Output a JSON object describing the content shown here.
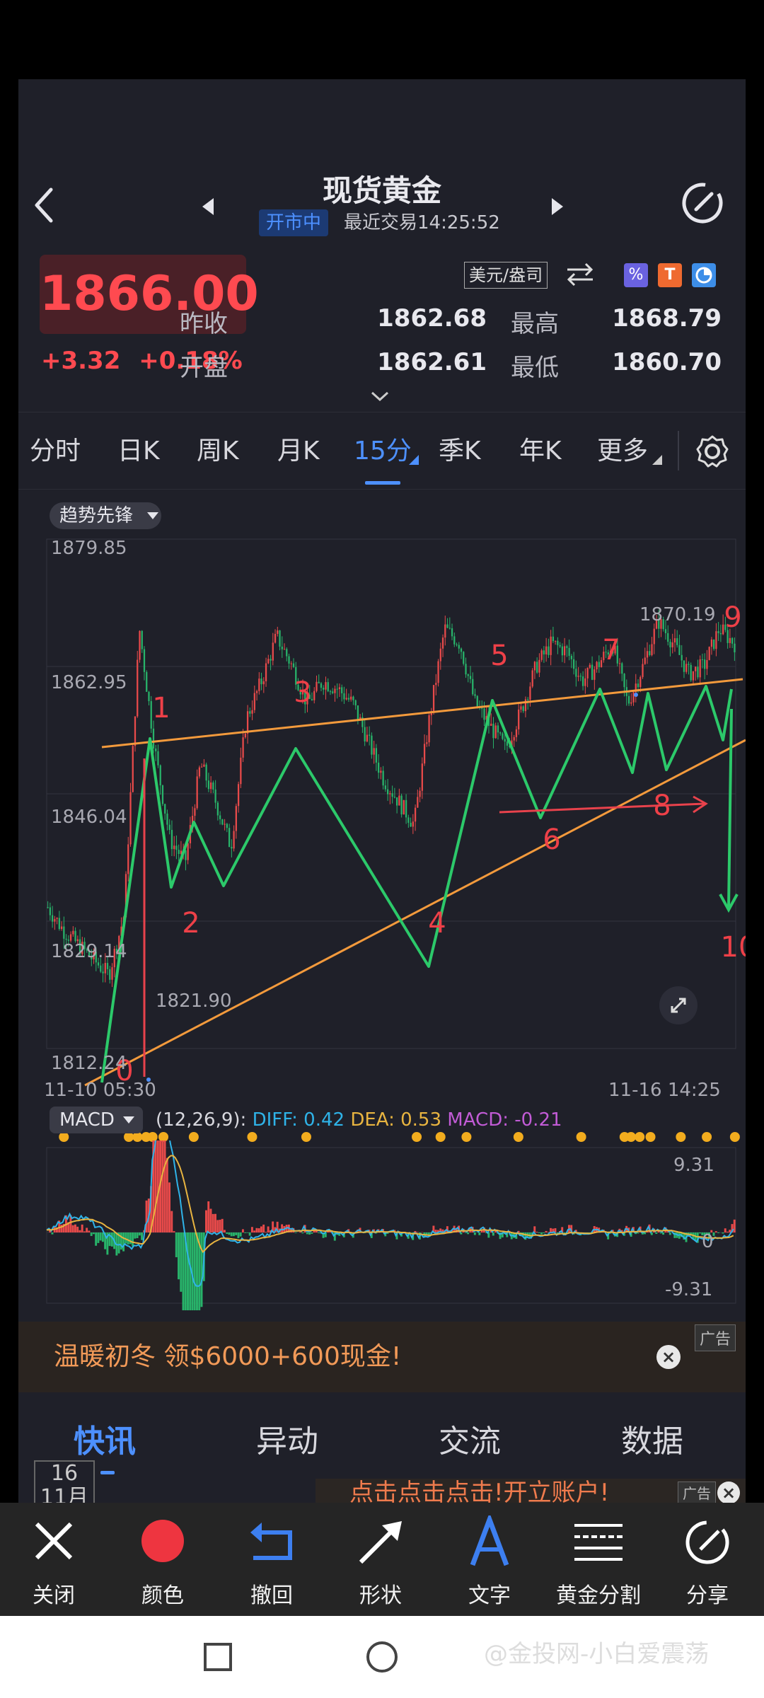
{
  "header": {
    "title": "现货黄金",
    "status_badge": "开市中",
    "last_trade": "最近交易14:25:52",
    "unit": "美元/盎司"
  },
  "quote": {
    "price": "1866.00",
    "change": "+3.32",
    "change_pct": "+0.18%",
    "stats": [
      {
        "label": "昨收",
        "value": "1862.68"
      },
      {
        "label": "最高",
        "value": "1868.79"
      },
      {
        "label": "开盘",
        "value": "1862.61"
      },
      {
        "label": "最低",
        "value": "1860.70"
      }
    ]
  },
  "period_tabs": [
    "分时",
    "日K",
    "周K",
    "月K",
    "15分",
    "季K",
    "年K",
    "更多"
  ],
  "active_period": "15分",
  "indicator_pill": "趋势先锋",
  "chart_data": {
    "type": "candlestick",
    "y_ticks": [
      "1879.85",
      "1862.95",
      "1846.04",
      "1829.14",
      "1812.24"
    ],
    "ylim": [
      1812.24,
      1879.85
    ],
    "x_start_label": "11-10 05:30",
    "x_end_label": "11-16 14:25",
    "max_label": "1870.19",
    "min_label": "1821.90",
    "price_path": [
      1831,
      1828,
      1826,
      1824,
      1822,
      1830,
      1868,
      1852,
      1840,
      1837,
      1850,
      1845,
      1839,
      1856,
      1861,
      1867,
      1863,
      1858,
      1861,
      1860,
      1858,
      1853,
      1848,
      1845,
      1842,
      1856,
      1868,
      1866,
      1858,
      1855,
      1852,
      1857,
      1863,
      1866,
      1865,
      1861,
      1863,
      1866,
      1858,
      1863,
      1869,
      1866,
      1862,
      1863,
      1868,
      1866
    ],
    "annotations": [
      "0",
      "1",
      "2",
      "3",
      "4",
      "5",
      "6",
      "7",
      "8",
      "9",
      "10"
    ]
  },
  "macd": {
    "label": "MACD",
    "params": "(12,26,9):",
    "diff": "DIFF: 0.42",
    "dea": "DEA: 0.53",
    "macd": "MACD: -0.21",
    "y_top": "9.31",
    "y_mid": "0",
    "y_bottom": "-9.31",
    "colors": {
      "diff": "#2fb3e8",
      "dea": "#e8b440",
      "macd": "#c25bd6"
    }
  },
  "ad_banner": {
    "text": "温暖初冬 领$6000+600现金!",
    "tag": "广告"
  },
  "news_tabs": [
    "快讯",
    "异动",
    "交流",
    "数据"
  ],
  "active_news_tab": "快讯",
  "date_box": {
    "day": "16",
    "month": "11月"
  },
  "ad_banner2": {
    "text": "点击点击点击!开立账户!",
    "tag": "广告"
  },
  "toolbar": [
    {
      "label": "关闭",
      "icon": "close-icon"
    },
    {
      "label": "颜色",
      "icon": "color-dot-icon"
    },
    {
      "label": "撤回",
      "icon": "undo-icon"
    },
    {
      "label": "形状",
      "icon": "arrow-icon"
    },
    {
      "label": "文字",
      "icon": "text-icon"
    },
    {
      "label": "黄金分割",
      "icon": "golden-ratio-icon"
    },
    {
      "label": "分享",
      "icon": "share-icon"
    }
  ],
  "watermark": "@金投网-小白爱震荡"
}
